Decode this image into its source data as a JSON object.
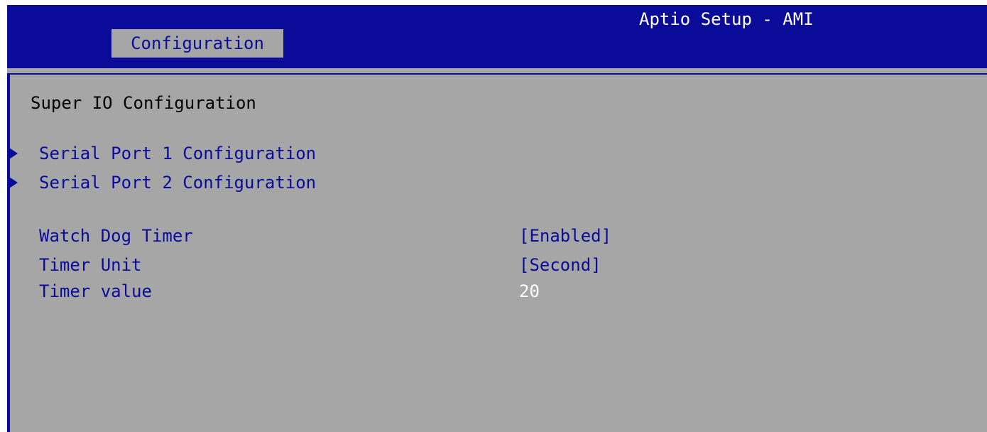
{
  "app": {
    "title": "Aptio Setup - AMI",
    "active_tab": "Configuration"
  },
  "colors": {
    "header_bg": "#0b0b9a",
    "panel_bg": "#a6a6a6",
    "accent": "#0b0b9a",
    "text_default": "#000000",
    "text_static_value": "#ffffff"
  },
  "page": {
    "section_title": "Super IO Configuration",
    "submenus": [
      {
        "label": "Serial Port 1 Configuration",
        "icon": "submenu-arrow-icon"
      },
      {
        "label": "Serial Port 2 Configuration",
        "icon": "submenu-arrow-icon"
      }
    ],
    "options": [
      {
        "label": "Watch Dog Timer",
        "value": "[Enabled]"
      },
      {
        "label": "Timer Unit",
        "value": "[Second]"
      },
      {
        "label": "Timer value",
        "value": "20"
      }
    ]
  }
}
